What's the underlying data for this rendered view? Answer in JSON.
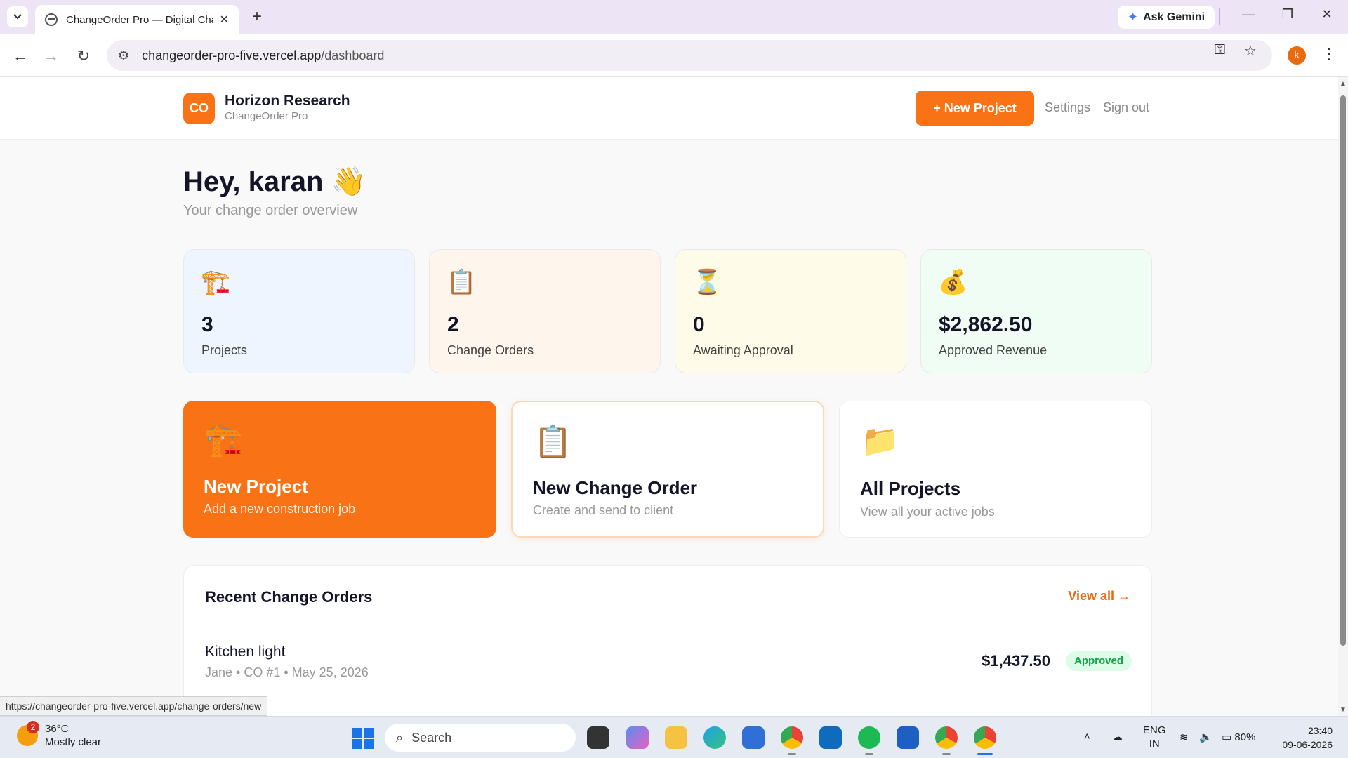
{
  "browser": {
    "tab_title": "ChangeOrder Pro — Digital Cha",
    "url_host": "changeorder-pro-five.vercel.app",
    "url_path": "/dashboard",
    "ask_gemini": "Ask Gemini",
    "profile_initial": "k",
    "status_url": "https://changeorder-pro-five.vercel.app/change-orders/new"
  },
  "header": {
    "logo_text": "CO",
    "org_name": "Horizon Research",
    "app_name": "ChangeOrder Pro",
    "new_project_label": "+ New Project",
    "settings_label": "Settings",
    "signout_label": "Sign out"
  },
  "greeting": {
    "title": "Hey, karan 👋",
    "subtitle": "Your change order overview"
  },
  "stats": [
    {
      "icon": "🏗️",
      "value": "3",
      "label": "Projects",
      "bg": "#eef5fe"
    },
    {
      "icon": "📋",
      "value": "2",
      "label": "Change Orders",
      "bg": "#fef6ec"
    },
    {
      "icon": "⏳",
      "value": "0",
      "label": "Awaiting Approval",
      "bg": "#fefce8"
    },
    {
      "icon": "💰",
      "value": "$2,862.50",
      "label": "Approved Revenue",
      "bg": "#f0fdf4"
    }
  ],
  "actions": [
    {
      "icon": "🏗️",
      "title": "New Project",
      "desc": "Add a new construction job"
    },
    {
      "icon": "📋",
      "title": "New Change Order",
      "desc": "Create and send to client"
    },
    {
      "icon": "📁",
      "title": "All Projects",
      "desc": "View all your active jobs"
    }
  ],
  "recent": {
    "heading": "Recent Change Orders",
    "view_all": "View all →",
    "rows": [
      {
        "title": "Kitchen light",
        "meta": "Jane • CO #1 • May 25, 2026",
        "amount": "$1,437.50",
        "status": "Approved"
      }
    ]
  },
  "taskbar": {
    "temp": "36°C",
    "weather": "Mostly clear",
    "weather_badge": "2",
    "search_label": "Search",
    "lang1": "ENG",
    "lang2": "IN",
    "battery": "80%",
    "time": "23:40",
    "date": "09-06-2026"
  },
  "colors": {
    "accent": "#f97316",
    "approved_bg": "#dcfce7",
    "approved_text": "#16a34a"
  }
}
